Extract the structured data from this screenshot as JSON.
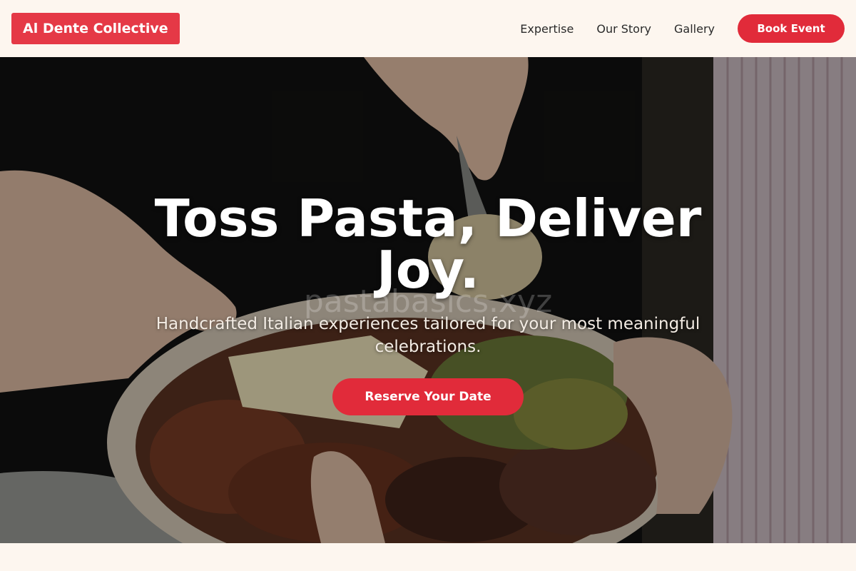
{
  "header": {
    "logo_text": "Al Dente Collective",
    "nav": [
      {
        "label": "Expertise"
      },
      {
        "label": "Our Story"
      },
      {
        "label": "Gallery"
      }
    ],
    "cta_label": "Book Event"
  },
  "hero": {
    "title": "Toss Pasta, Deliver Joy.",
    "watermark": "pastabasics.xyz",
    "subtitle": "Handcrafted Italian experiences tailored for your most meaningful celebrations.",
    "cta_label": "Reserve Your Date",
    "image_description_icon": "food-plate-photo"
  },
  "colors": {
    "accent": "#e12b3a",
    "logo_bg": "#e53946",
    "page_bg": "#fdf6ef",
    "text_dark": "#2a2a2a"
  }
}
